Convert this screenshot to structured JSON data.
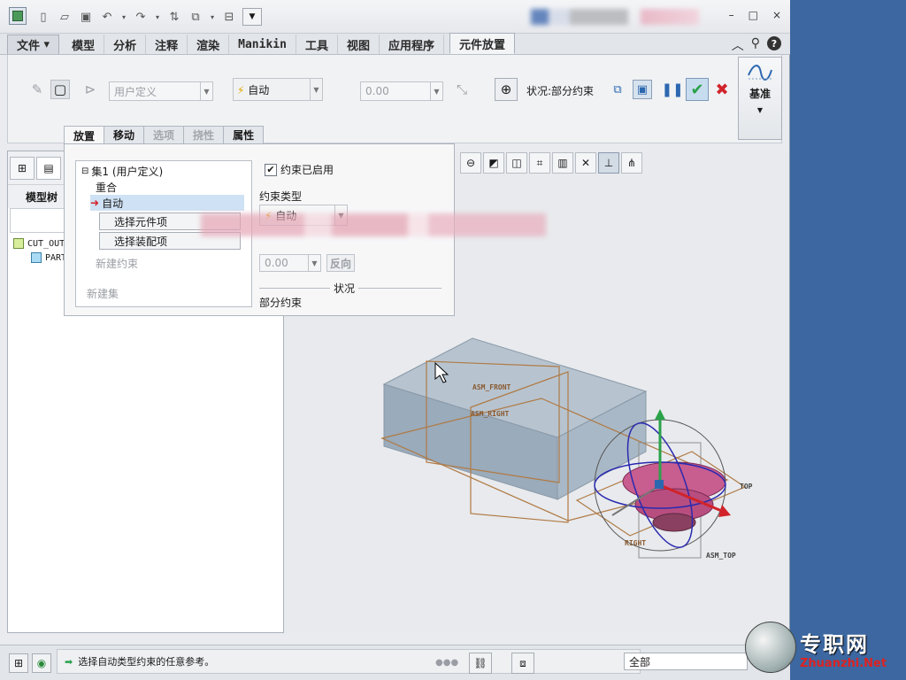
{
  "titlebar": {
    "window_controls": [
      "–",
      "□",
      "×"
    ]
  },
  "menubar": {
    "tabs": [
      "文件",
      "模型",
      "分析",
      "注释",
      "渲染",
      "Manikin",
      "工具",
      "视图",
      "应用程序",
      "元件放置"
    ],
    "active_tab": "元件放置"
  },
  "ribbon": {
    "constraint_set_combo": "用户定义",
    "constraint_type_combo": "自动",
    "offset_value": "0.00",
    "status_label": "状况:部分约束",
    "datum_label": "基准"
  },
  "placement_tabs": [
    "放置",
    "移动",
    "选项",
    "挠性",
    "属性"
  ],
  "placement_panel": {
    "set_label": "集1 (用户定义)",
    "coincident": "重合",
    "auto": "自动",
    "select_component": "选择元件项",
    "select_assembly": "选择装配项",
    "new_constraint": "新建约束",
    "new_set": "新建集",
    "constraint_enabled": "约束已启用",
    "constraint_type_label": "约束类型",
    "constraint_type_value": "自动",
    "offset_value": "0.00",
    "flip_button": "反向",
    "status_heading": "状况",
    "status_value": "部分约束"
  },
  "model_tree": {
    "title": "模型树",
    "items": [
      "CUT_OUT",
      "PART"
    ]
  },
  "viewport": {
    "labels": [
      "ASM_FRONT",
      "ASM_RIGHT",
      "TOP",
      "RIGHT",
      "ASM_TOP"
    ]
  },
  "statusbar": {
    "message": "选择自动类型约束的任意参考。",
    "filter": "全部"
  },
  "watermark": {
    "brand": "专职网",
    "url": "Zhuanzhi.Net"
  },
  "colors": {
    "desktop": "#3c67a0",
    "accent_blue": "#2c68b0",
    "ok_green": "#2aa24a",
    "cancel_red": "#d2232a",
    "selection": "#cfe2f5"
  }
}
